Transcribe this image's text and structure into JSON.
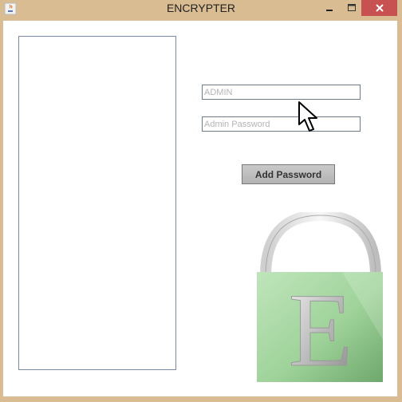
{
  "window": {
    "title": "ENCRYPTER"
  },
  "titlebar": {
    "app_icon": "java-cup-icon",
    "buttons": [
      "minimize-icon",
      "maximize-icon",
      "close-icon"
    ]
  },
  "form": {
    "admin_placeholder": "ADMIN",
    "password_placeholder": "Admin Password",
    "add_button_label": "Add Password"
  },
  "logo": {
    "letter": "E",
    "icon": "padlock-icon"
  },
  "cursor": {
    "icon": "arrow-cursor-icon"
  },
  "colors": {
    "frame": "#d9bc92",
    "close": "#c75050",
    "lock_green": "#9fd39a"
  }
}
